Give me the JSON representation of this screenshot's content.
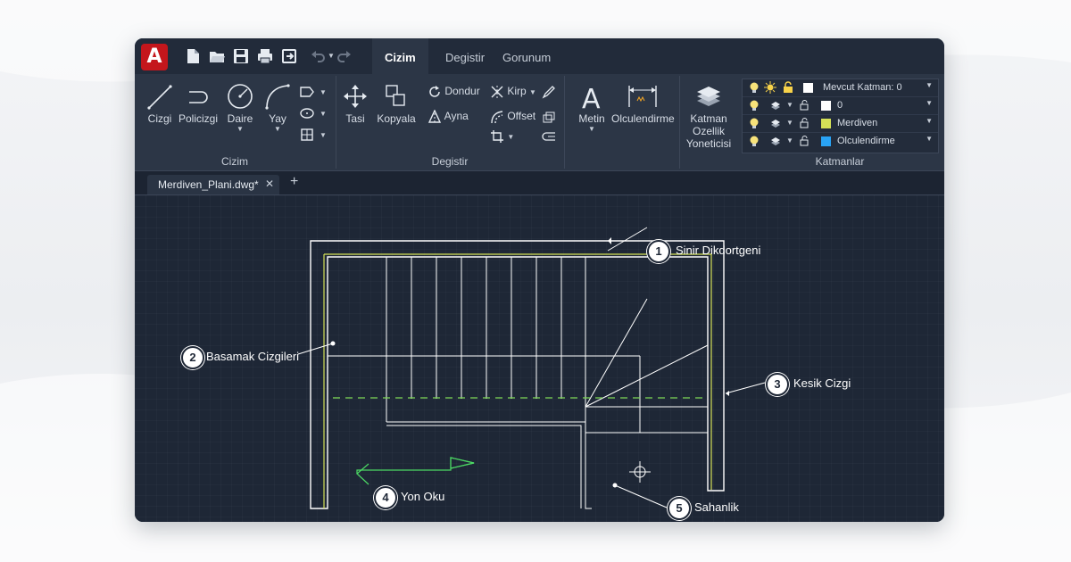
{
  "app": {
    "logo_letter": "A",
    "brand_color": "#c4161c",
    "quick_access_icons": [
      "new-file-icon",
      "open-folder-icon",
      "save-icon",
      "print-icon",
      "save-as-icon",
      "undo-icon",
      "redo-icon"
    ]
  },
  "menu": {
    "tabs": [
      {
        "label": "Cizim",
        "active": true
      },
      {
        "label": "Degistir",
        "active": false
      },
      {
        "label": "Gorunum",
        "active": false
      }
    ]
  },
  "ribbon": {
    "cizim": {
      "title": "Cizim",
      "tools": [
        {
          "label": "Cizgi",
          "icon": "line-icon"
        },
        {
          "label": "Policizgi",
          "icon": "polyline-icon"
        },
        {
          "label": "Daire",
          "icon": "circle-icon"
        },
        {
          "label": "Yay",
          "icon": "arc-icon"
        }
      ],
      "small_icons": [
        "rectangle-icon",
        "ellipse-icon",
        "hatch-icon"
      ]
    },
    "degistir": {
      "title": "Degistir",
      "tools": [
        {
          "label": "Tasi",
          "icon": "move-icon"
        },
        {
          "label": "Kopyala",
          "icon": "copy-icon"
        }
      ],
      "small_tools": [
        {
          "label": "Dondur",
          "icon": "rotate-icon"
        },
        {
          "label": "Kirp",
          "icon": "trim-icon"
        },
        {
          "label": "Ayna",
          "icon": "mirror-icon"
        },
        {
          "label": "Offset",
          "icon": "offset-icon"
        }
      ]
    },
    "annotation": {
      "tools": [
        {
          "label": "Metin",
          "icon": "text-icon"
        },
        {
          "label": "Olculendirme",
          "icon": "dimension-icon"
        }
      ]
    },
    "katmanlar": {
      "title": "Katmanlar",
      "manager_label_lines": [
        "Katman",
        "Ozellik",
        "Yoneticisi"
      ],
      "current_layer": "Mevcut Katman: 0",
      "layers": [
        {
          "name": "0",
          "color": "#ffffff"
        },
        {
          "name": "Merdiven",
          "color": "#d4e157"
        },
        {
          "name": "Olculendirme",
          "color": "#29a3f5"
        }
      ]
    }
  },
  "document": {
    "tab_title": "Merdiven_Plani.dwg*",
    "close_symbol": "✕",
    "add_symbol": "+"
  },
  "drawing": {
    "callouts": [
      {
        "number": "1",
        "label": "Sinir Dikdortgeni"
      },
      {
        "number": "2",
        "label": "Basamak Cizgileri"
      },
      {
        "number": "3",
        "label": "Kesik Cizgi"
      },
      {
        "number": "4",
        "label": "Yon Oku"
      },
      {
        "number": "5",
        "label": "Sahanlik"
      }
    ],
    "colors": {
      "outline": "#ffffff",
      "stair_layer": "#d4e157",
      "cut_line": "#7ed957",
      "arrow": "#4cd964"
    }
  }
}
